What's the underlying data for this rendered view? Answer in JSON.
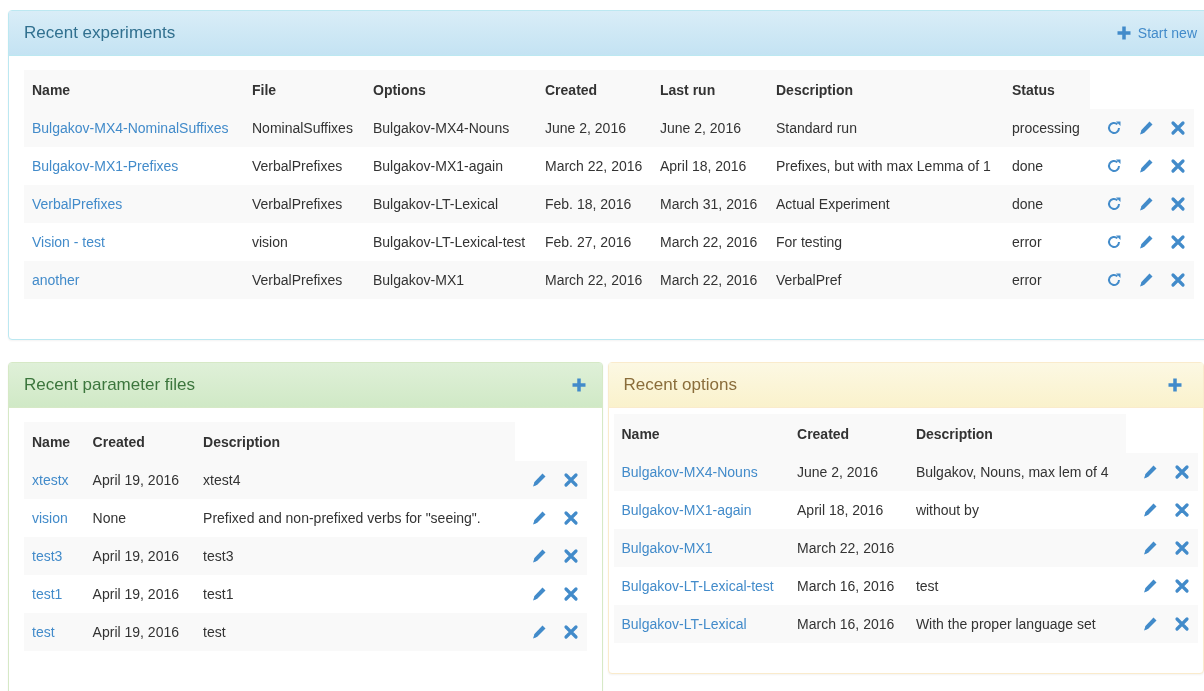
{
  "panels": [
    {
      "title": "Recent experiments",
      "kind": "info",
      "action_label": "Start new",
      "table": {
        "columns": [
          {
            "label": "Name",
            "kind": "link"
          },
          {
            "label": "File",
            "kind": "text"
          },
          {
            "label": "Options",
            "kind": "text"
          },
          {
            "label": "Created",
            "kind": "text"
          },
          {
            "label": "Last run",
            "kind": "text"
          },
          {
            "label": "Description",
            "kind": "text"
          },
          {
            "label": "Status",
            "kind": "text"
          }
        ],
        "rows": [
          {
            "cells": [
              "Bulgakov-MX4-NominalSuffixes",
              "NominalSuffixes",
              "Bulgakov-MX4-Nouns",
              "June 2, 2016",
              "June 2, 2016",
              "Standard run",
              "processing"
            ]
          },
          {
            "cells": [
              "Bulgakov-MX1-Prefixes",
              "VerbalPrefixes",
              "Bulgakov-MX1-again",
              "March 22, 2016",
              "April 18, 2016",
              "Prefixes, but with max Lemma of 1",
              "done"
            ]
          },
          {
            "cells": [
              "VerbalPrefixes",
              "VerbalPrefixes",
              "Bulgakov-LT-Lexical",
              "Feb. 18, 2016",
              "March 31, 2016",
              "Actual Experiment",
              "done"
            ]
          },
          {
            "cells": [
              "Vision - test",
              "vision",
              "Bulgakov-LT-Lexical-test",
              "Feb. 27, 2016",
              "March 22, 2016",
              "For testing",
              "error"
            ]
          },
          {
            "cells": [
              "another",
              "VerbalPrefixes",
              "Bulgakov-MX1",
              "March 22, 2016",
              "March 22, 2016",
              "VerbalPref",
              "error"
            ]
          }
        ]
      }
    },
    {
      "title": "Recent parameter files",
      "kind": "success",
      "table": {
        "columns": [
          {
            "label": "Name",
            "kind": "link"
          },
          {
            "label": "Created",
            "kind": "text"
          },
          {
            "label": "Description",
            "kind": "text"
          }
        ],
        "rows": [
          {
            "cells": [
              "xtestx",
              "April 19, 2016",
              "xtest4"
            ]
          },
          {
            "cells": [
              "vision",
              "None",
              "Prefixed and non-prefixed verbs for \"seeing\"."
            ]
          },
          {
            "cells": [
              "test3",
              "April 19, 2016",
              "test3"
            ]
          },
          {
            "cells": [
              "test1",
              "April 19, 2016",
              "test1"
            ]
          },
          {
            "cells": [
              "test",
              "April 19, 2016",
              "test"
            ]
          }
        ]
      }
    },
    {
      "title": "Recent options",
      "kind": "warning",
      "table": {
        "columns": [
          {
            "label": "Name",
            "kind": "link"
          },
          {
            "label": "Created",
            "kind": "text"
          },
          {
            "label": "Description",
            "kind": "text"
          }
        ],
        "rows": [
          {
            "cells": [
              "Bulgakov-MX4-Nouns",
              "June 2, 2016",
              "Bulgakov, Nouns, max lem of 4"
            ]
          },
          {
            "cells": [
              "Bulgakov-MX1-again",
              "April 18, 2016",
              "without by"
            ]
          },
          {
            "cells": [
              "Bulgakov-MX1",
              "March 22, 2016",
              null
            ]
          },
          {
            "cells": [
              "Bulgakov-LT-Lexical-test",
              "March 16, 2016",
              "test"
            ]
          },
          {
            "cells": [
              "Bulgakov-LT-Lexical",
              "March 16, 2016",
              "With the proper language set"
            ]
          }
        ]
      }
    }
  ]
}
